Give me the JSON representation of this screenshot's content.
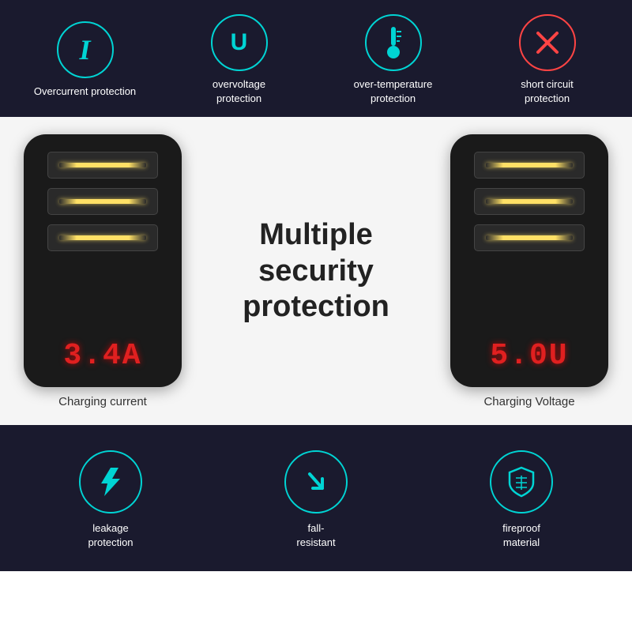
{
  "top": {
    "features": [
      {
        "id": "overcurrent",
        "icon_type": "I",
        "label": "Overcurrent\nprotection"
      },
      {
        "id": "overvoltage",
        "icon_type": "U",
        "label": "overvoltage\nprotection"
      },
      {
        "id": "overtemp",
        "icon_type": "thermometer",
        "label": "over-temperature\nprotection"
      },
      {
        "id": "shortcircuit",
        "icon_type": "X",
        "label": "short circuit\nprotection"
      }
    ]
  },
  "middle": {
    "left_charger": {
      "display": "3.4A",
      "label": "Charging current"
    },
    "right_charger": {
      "display": "5.0U",
      "label": "Charging Voltage"
    },
    "center_text": "Multiple\nsecurity\nprotection"
  },
  "bottom": {
    "features": [
      {
        "id": "leakage",
        "icon_type": "bolt",
        "label": "leakage\nprotection"
      },
      {
        "id": "fall",
        "icon_type": "arrow-down",
        "label": "fall-\nresistant"
      },
      {
        "id": "fireproof",
        "icon_type": "shield",
        "label": "fireproof\nmaterial"
      }
    ]
  }
}
